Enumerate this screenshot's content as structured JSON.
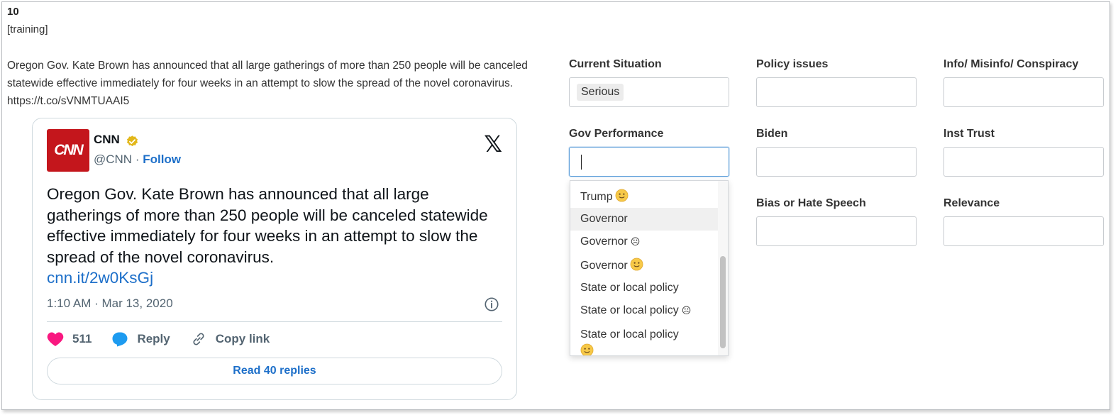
{
  "item": {
    "number": "10",
    "tag": "[training]",
    "text": "Oregon Gov. Kate Brown has announced that all large gatherings of more than 250 people will be canceled statewide effective immediately for four weeks in an attempt to slow the spread of the novel coronavirus. https://t.co/sVNMTUAAI5"
  },
  "tweet": {
    "avatar_text": "CNN",
    "author": "CNN",
    "handle": "@CNN",
    "separator": " · ",
    "follow": "Follow",
    "body": "Oregon Gov. Kate Brown has announced that all large gatherings of more than 250 people will be canceled statewide effective immediately for four weeks in an attempt to slow the spread of the novel coronavirus.",
    "link": "cnn.it/2w0KsGj",
    "timestamp": "1:10 AM · Mar 13, 2020",
    "likes": "511",
    "reply": "Reply",
    "copy_link": "Copy link",
    "read_replies": "Read 40 replies",
    "brand_x": "𝕏",
    "colors": {
      "like": "#f91880",
      "reply": "#1d9bf0",
      "link": "#1d6fc9",
      "verified": "#e2b719"
    }
  },
  "fields": {
    "current_situation": {
      "label": "Current Situation",
      "value": "Serious"
    },
    "policy_issues": {
      "label": "Policy issues"
    },
    "info_misinfo": {
      "label": "Info/ Misinfo/ Conspiracy"
    },
    "gov_performance": {
      "label": "Gov Performance"
    },
    "biden": {
      "label": "Biden"
    },
    "inst_trust": {
      "label": "Inst Trust"
    },
    "bias_hate": {
      "label": "Bias or Hate Speech"
    },
    "relevance": {
      "label": "Relevance"
    }
  },
  "dropdown": {
    "options": [
      {
        "label": "Trump",
        "emoji": "smile"
      },
      {
        "label": "Governor",
        "emoji": ""
      },
      {
        "label": "Governor",
        "emoji": "frown"
      },
      {
        "label": "Governor",
        "emoji": "smile"
      },
      {
        "label": "State or local policy",
        "emoji": ""
      },
      {
        "label": "State or local policy",
        "emoji": "frown"
      },
      {
        "label": "State or local policy",
        "emoji": "smile"
      }
    ],
    "frown_glyph": "☹"
  }
}
